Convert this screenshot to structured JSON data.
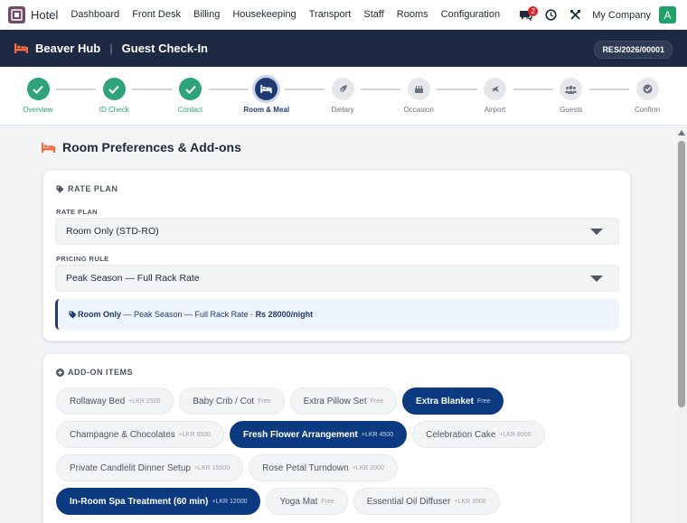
{
  "topbar": {
    "app_name": "Hotel",
    "menu": [
      "Dashboard",
      "Front Desk",
      "Billing",
      "Housekeeping",
      "Transport",
      "Staff",
      "Rooms",
      "Configuration"
    ],
    "chat_badge": "2",
    "company": "My Company",
    "avatar_letter": "A",
    "icons": [
      "chat-icon",
      "clock-icon",
      "tools-icon"
    ]
  },
  "header": {
    "hub": "Beaver Hub",
    "separator": "|",
    "page": "Guest Check-In",
    "reservation": "RES/2026/00001",
    "accent": "#f26b3a"
  },
  "stepper": {
    "steps": [
      {
        "label": "Overview",
        "state": "done",
        "icon": "check-icon"
      },
      {
        "label": "ID Check",
        "state": "done",
        "icon": "check-icon"
      },
      {
        "label": "Contact",
        "state": "done",
        "icon": "check-icon"
      },
      {
        "label": "Room & Meal",
        "state": "active",
        "icon": "bed-icon"
      },
      {
        "label": "Dietary",
        "state": "todo",
        "icon": "leaf-icon"
      },
      {
        "label": "Occasion",
        "state": "todo",
        "icon": "cake-icon"
      },
      {
        "label": "Airport",
        "state": "todo",
        "icon": "plane-icon"
      },
      {
        "label": "Guests",
        "state": "todo",
        "icon": "users-icon"
      },
      {
        "label": "Confirm",
        "state": "todo",
        "icon": "check-circle-icon"
      }
    ]
  },
  "main": {
    "title": "Room Preferences & Add-ons",
    "rate_plan_card": {
      "heading": "RATE PLAN",
      "rate_plan_label": "RATE PLAN",
      "rate_plan_value": "Room Only (STD-RO)",
      "pricing_rule_label": "PRICING RULE",
      "pricing_rule_value": "Peak Season — Full Rack Rate",
      "summary_plan": "Room Only",
      "summary_middle": " — Peak Season — Full Rack Rate · ",
      "summary_rate": "Rs 28000/night"
    },
    "addons_card": {
      "heading": "ADD-ON ITEMS",
      "rows": [
        [
          {
            "name": "Rollaway Bed",
            "price": "+LKR 2500",
            "selected": false
          },
          {
            "name": "Baby Crib / Cot",
            "price": "Free",
            "selected": false
          },
          {
            "name": "Extra Pillow Set",
            "price": "Free",
            "selected": false
          },
          {
            "name": "Extra Blanket",
            "price": "Free",
            "selected": true
          }
        ],
        [
          {
            "name": "Champagne & Chocolates",
            "price": "+LKR 8500",
            "selected": false
          },
          {
            "name": "Fresh Flower Arrangement",
            "price": "+LKR 4500",
            "selected": true
          },
          {
            "name": "Celebration Cake",
            "price": "+LKR 6500",
            "selected": false
          }
        ],
        [
          {
            "name": "Private Candlelit Dinner Setup",
            "price": "+LKR 15000",
            "selected": false
          },
          {
            "name": "Rose Petal Turndown",
            "price": "+LKR 2000",
            "selected": false
          }
        ],
        [
          {
            "name": "In-Room Spa Treatment (60 min)",
            "price": "+LKR 12000",
            "selected": true
          },
          {
            "name": "Yoga Mat",
            "price": "Free",
            "selected": false
          },
          {
            "name": "Essential Oil Diffuser",
            "price": "+LKR 3500",
            "selected": false
          }
        ]
      ]
    }
  }
}
